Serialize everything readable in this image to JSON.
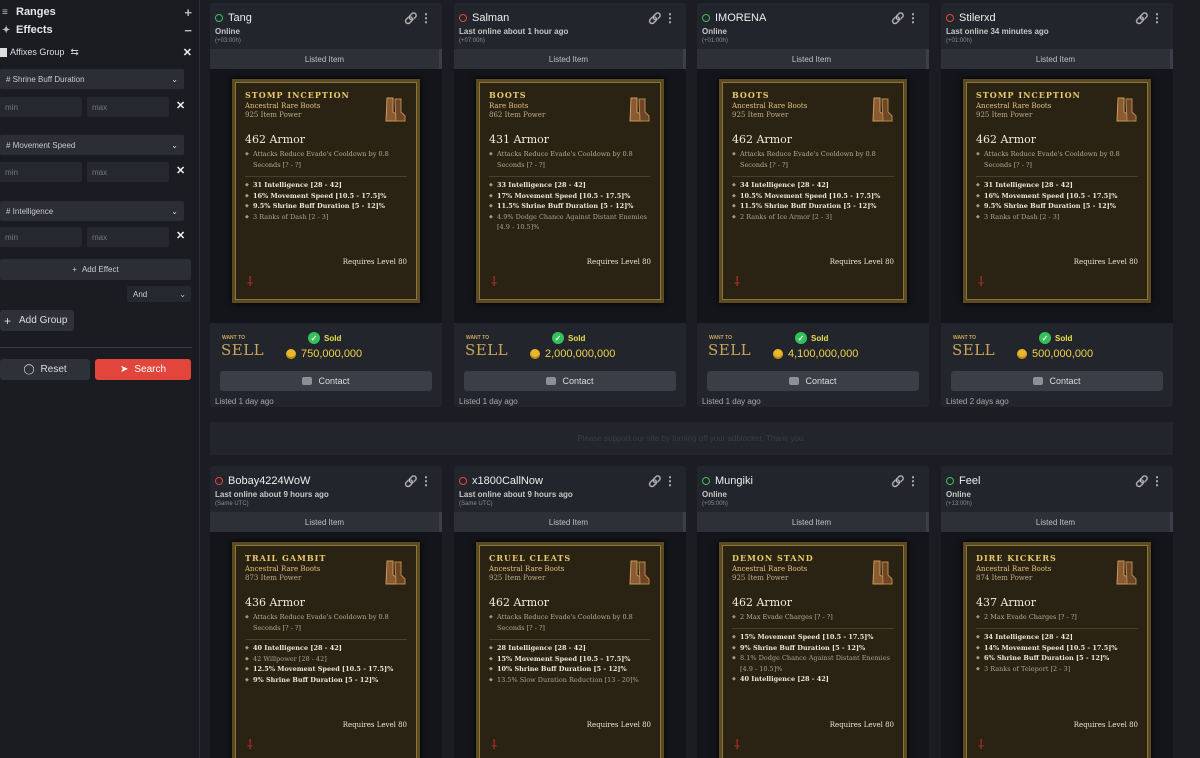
{
  "sidebar": {
    "ranges_label": "Ranges",
    "ranges_toggle": "+",
    "effects_label": "Effects",
    "effects_toggle": "−",
    "group_label": "Affixes Group",
    "filters": [
      {
        "label": "# Shrine Buff Duration",
        "min": "min",
        "max": "max"
      },
      {
        "label": "# Movement Speed",
        "min": "min",
        "max": "max"
      },
      {
        "label": "# Intelligence",
        "min": "min",
        "max": "max"
      }
    ],
    "add_effect": "Add Effect",
    "logic_select": "And",
    "add_group": "Add Group",
    "reset": "Reset",
    "search": "Search"
  },
  "listed_item_label": "Listed Item",
  "want_to_label": "WANT TO",
  "sell_label": "SELL",
  "sold_label": "Sold",
  "contact_label": "Contact",
  "banner_text": "Please support our site by turning off your adblocker. Thank you.",
  "listings": [
    {
      "user": "Tang",
      "online": true,
      "status": "Online",
      "tz": "(+03:00h)",
      "item": {
        "name": "Stomp Inception",
        "type": "Ancestral Rare Boots",
        "power": "925 Item Power",
        "armor": "462 Armor",
        "implicit": [
          "Attacks Reduce Evade's Cooldown by 0.8 Seconds [? - ?]"
        ],
        "affixes": [
          {
            "t": "31 Intelligence [28 - 42]"
          },
          {
            "t": "16% Movement Speed [10.5 - 17.5]%"
          },
          {
            "t": "9.5% Shrine Buff Duration [5 - 12]%"
          },
          {
            "t": "3 Ranks of Dash [2 - 3]",
            "dim": true
          }
        ],
        "req": "Requires Level 80"
      },
      "price": "750,000,000",
      "listed": "Listed 1 day ago"
    },
    {
      "user": "Salman",
      "online": false,
      "status": "Last online about 1 hour ago",
      "tz": "(+07:00h)",
      "item": {
        "name": "Boots",
        "type": "Rare Boots",
        "power": "862 Item Power",
        "armor": "431 Armor",
        "implicit": [
          "Attacks Reduce Evade's Cooldown by 0.8 Seconds [? - ?]"
        ],
        "affixes": [
          {
            "t": "33 Intelligence [28 - 42]"
          },
          {
            "t": "17% Movement Speed [10.5 - 17.5]%"
          },
          {
            "t": "11.5% Shrine Buff Duration [5 - 12]%"
          },
          {
            "t": "4.9% Dodge Chance Against Distant Enemies [4.9 - 10.5]%",
            "dim": true
          }
        ],
        "req": "Requires Level 80"
      },
      "price": "2,000,000,000",
      "listed": "Listed 1 day ago"
    },
    {
      "user": "IMORENA",
      "online": true,
      "status": "Online",
      "tz": "(+01:00h)",
      "item": {
        "name": "Boots",
        "type": "Ancestral Rare Boots",
        "power": "925 Item Power",
        "armor": "462 Armor",
        "implicit": [
          "Attacks Reduce Evade's Cooldown by 0.8 Seconds [? - ?]"
        ],
        "affixes": [
          {
            "t": "34 Intelligence [28 - 42]"
          },
          {
            "t": "10.5% Movement Speed [10.5 - 17.5]%"
          },
          {
            "t": "11.5% Shrine Buff Duration [5 - 12]%"
          },
          {
            "t": "2 Ranks of Ice Armor [2 - 3]",
            "dim": true
          }
        ],
        "req": "Requires Level 80"
      },
      "price": "4,100,000,000",
      "listed": "Listed 1 day ago"
    },
    {
      "user": "Stilerxd",
      "online": false,
      "status": "Last online 34 minutes ago",
      "tz": "(+01:00h)",
      "item": {
        "name": "Stomp Inception",
        "type": "Ancestral Rare Boots",
        "power": "925 Item Power",
        "armor": "462 Armor",
        "implicit": [
          "Attacks Reduce Evade's Cooldown by 0.8 Seconds [? - ?]"
        ],
        "affixes": [
          {
            "t": "31 Intelligence [28 - 42]"
          },
          {
            "t": "16% Movement Speed [10.5 - 17.5]%"
          },
          {
            "t": "9.5% Shrine Buff Duration [5 - 12]%"
          },
          {
            "t": "3 Ranks of Dash [2 - 3]",
            "dim": true
          }
        ],
        "req": "Requires Level 80"
      },
      "price": "500,000,000",
      "listed": "Listed 2 days ago"
    },
    {
      "user": "Bobay4224WoW",
      "online": false,
      "status": "Last online about 9 hours ago",
      "tz": "(Same UTC)",
      "item": {
        "name": "Trail Gambit",
        "type": "Ancestral Rare Boots",
        "power": "873 Item Power",
        "armor": "436 Armor",
        "implicit": [
          "Attacks Reduce Evade's Cooldown by 0.8 Seconds [? - ?]"
        ],
        "affixes": [
          {
            "t": "40 Intelligence [28 - 42]"
          },
          {
            "t": "42 Willpower [28 - 42]",
            "dim": true
          },
          {
            "t": "12.5% Movement Speed [10.5 - 17.5]%"
          },
          {
            "t": "9% Shrine Buff Duration [5 - 12]%"
          }
        ],
        "req": "Requires Level 80"
      }
    },
    {
      "user": "x1800CallNow",
      "online": false,
      "status": "Last online about 9 hours ago",
      "tz": "(Same UTC)",
      "item": {
        "name": "Cruel Cleats",
        "type": "Ancestral Rare Boots",
        "power": "925 Item Power",
        "armor": "462 Armor",
        "implicit": [
          "Attacks Reduce Evade's Cooldown by 0.8 Seconds [? - ?]"
        ],
        "affixes": [
          {
            "t": "28 Intelligence [28 - 42]"
          },
          {
            "t": "15% Movement Speed [10.5 - 17.5]%"
          },
          {
            "t": "10% Shrine Buff Duration [5 - 12]%"
          },
          {
            "t": "13.5% Slow Duration Reduction [13 - 20]%",
            "dim": true
          }
        ],
        "req": "Requires Level 80"
      }
    },
    {
      "user": "Mungiki",
      "online": true,
      "status": "Online",
      "tz": "(+05:00h)",
      "item": {
        "name": "Demon Stand",
        "type": "Ancestral Rare Boots",
        "power": "925 Item Power",
        "armor": "462 Armor",
        "implicit": [
          "2 Max Evade Charges [? - ?]"
        ],
        "affixes": [
          {
            "t": "15% Movement Speed [10.5 - 17.5]%"
          },
          {
            "t": "9% Shrine Buff Duration [5 - 12]%"
          },
          {
            "t": "8.1% Dodge Chance Against Distant Enemies [4.9 - 10.5]%",
            "dim": true
          },
          {
            "t": "40 Intelligence [28 - 42]"
          }
        ],
        "req": "Requires Level 80"
      }
    },
    {
      "user": "Feel",
      "online": true,
      "status": "Online",
      "tz": "(+13:00h)",
      "item": {
        "name": "Dire Kickers",
        "type": "Ancestral Rare Boots",
        "power": "874 Item Power",
        "armor": "437 Armor",
        "implicit": [
          "2 Max Evade Charges [? - ?]"
        ],
        "affixes": [
          {
            "t": "34 Intelligence [28 - 42]"
          },
          {
            "t": "14% Movement Speed [10.5 - 17.5]%"
          },
          {
            "t": "6% Shrine Buff Duration [5 - 12]%"
          },
          {
            "t": "3 Ranks of Teleport [2 - 3]",
            "dim": true
          }
        ],
        "req": "Requires Level 80"
      }
    }
  ]
}
